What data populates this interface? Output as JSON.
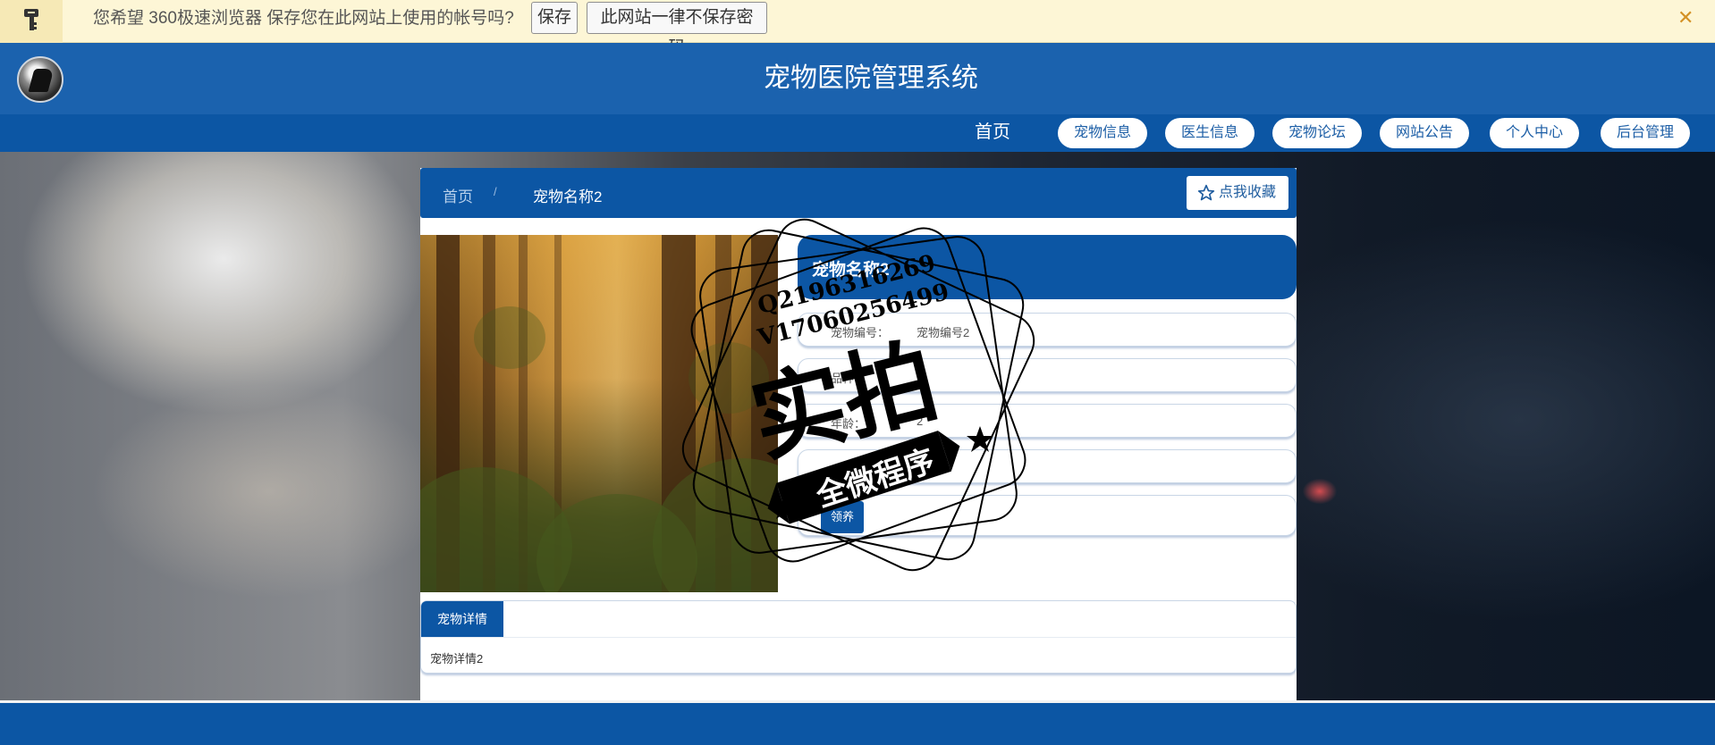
{
  "password_bar": {
    "message": "您希望 360极速浏览器 保存您在此网站上使用的帐号吗?",
    "save_label": "保存",
    "never_label": "此网站一律不保存密码",
    "close_label": "✕"
  },
  "header": {
    "title": "宠物医院管理系统"
  },
  "nav": {
    "home": "首页",
    "items": [
      "宠物信息",
      "医生信息",
      "宠物论坛",
      "网站公告",
      "个人中心",
      "后台管理"
    ]
  },
  "breadcrumb": {
    "home": "首页",
    "separator": "/",
    "current": "宠物名称2"
  },
  "collect_label": "点我收藏",
  "pet": {
    "name": "宠物名称2",
    "fields": [
      {
        "label": "宠物编号：",
        "value": "宠物编号2"
      },
      {
        "label": "品种：",
        "value": ""
      },
      {
        "label": "年龄：",
        "value": "2"
      },
      {
        "label": "",
        "value": ""
      }
    ],
    "adopt_label": "领养"
  },
  "detail": {
    "tab_label": "宠物详情",
    "content": "宠物详情2"
  },
  "watermark": {
    "line1": "Q2196316269",
    "line2": "V17060256499",
    "big": "实拍",
    "banner": "全微程序"
  }
}
